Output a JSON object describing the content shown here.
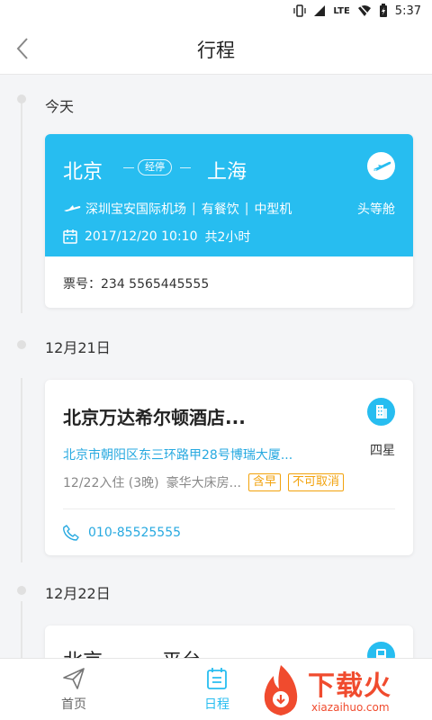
{
  "status_bar": {
    "time": "5:37",
    "network": "LTE"
  },
  "header": {
    "title": "行程"
  },
  "sections": [
    {
      "date": "今天"
    },
    {
      "date": "12月21日"
    },
    {
      "date": "12月22日"
    }
  ],
  "flight": {
    "from": "北京",
    "via": "经停",
    "to": "上海",
    "airport": "深圳宝安国际机场",
    "meal": "有餐饮",
    "aircraft": "中型机",
    "cabin": "头等舱",
    "datetime": "2017/12/20 10:10",
    "duration": "共2小时",
    "ticket": "票号：234 5565445555"
  },
  "hotel": {
    "name": "北京万达希尔顿酒店...",
    "stars": "四星",
    "address": "北京市朝阳区东三环路甲28号博瑞大厦...",
    "stay": "12/22入住 (3晚)",
    "room": "豪华大床房...",
    "tags": [
      "含早",
      "不可取消"
    ],
    "phone": "010-85525555"
  },
  "train": {
    "from": "北京",
    "to": "平台"
  },
  "tabbar": {
    "home": "首页",
    "schedule": "日程"
  },
  "watermark": {
    "title": "下载火",
    "sub": "xiazaihuo.com"
  },
  "colors": {
    "accent": "#27bdf0",
    "tag": "#f2a20c",
    "link": "#27a9e0",
    "logo": "#f04b2e"
  }
}
